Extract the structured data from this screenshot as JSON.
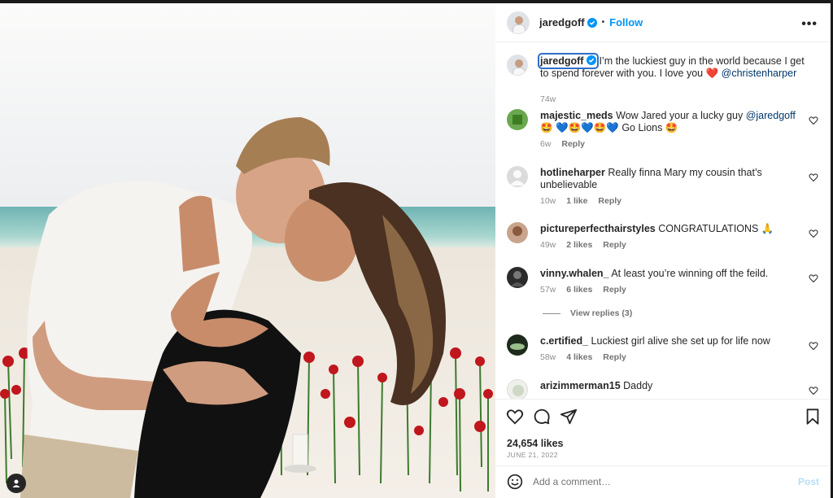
{
  "post": {
    "author": "jaredgoff",
    "follow_label": "Follow",
    "more_label": "•••",
    "separator": "•"
  },
  "caption": {
    "author": "jaredgoff",
    "text": "I’m the luckiest guy in the world because I get to spend forever with you. I love you ❤️",
    "mention": "@christenharper",
    "age": "74w"
  },
  "comments": [
    {
      "user": "majestic_meds",
      "text": "Wow Jared your a lucky guy",
      "mention": "@jaredgoff",
      "text2": "🤩 💙🤩💙🤩💙 Go Lions 🤩",
      "age": "6w",
      "likes": "",
      "reply": "Reply"
    },
    {
      "user": "hotlineharper",
      "text": "Really finna Mary my cousin that’s unbelievable",
      "age": "10w",
      "likes": "1 like",
      "reply": "Reply"
    },
    {
      "user": "pictureperfecthairstyles",
      "text": "CONGRATULATIONS 🙏",
      "age": "49w",
      "likes": "2 likes",
      "reply": "Reply"
    },
    {
      "user": "vinny.whalen_",
      "text": "At least you’re winning off the feild.",
      "age": "57w",
      "likes": "6 likes",
      "reply": "Reply"
    },
    {
      "user": "c.ertified_",
      "text": "Luckiest girl alive she set up for life now",
      "age": "58w",
      "likes": "4 likes",
      "reply": "Reply"
    },
    {
      "user": "arizimmerman15",
      "text": "Daddy",
      "age": "",
      "likes": "",
      "reply": ""
    }
  ],
  "view_replies": "View replies (3)",
  "stats": {
    "likes": "24,654 likes",
    "date": "JUNE 21, 2022"
  },
  "composer": {
    "placeholder": "Add a comment…",
    "post_label": "Post"
  },
  "colors": {
    "accent": "#0095f6",
    "verified": "#0095f6",
    "heart": "#ed4956"
  },
  "icons": [
    "heart-icon",
    "comment-icon",
    "share-icon",
    "bookmark-icon",
    "emoji-icon",
    "verified-icon",
    "more-icon",
    "user-icon"
  ]
}
